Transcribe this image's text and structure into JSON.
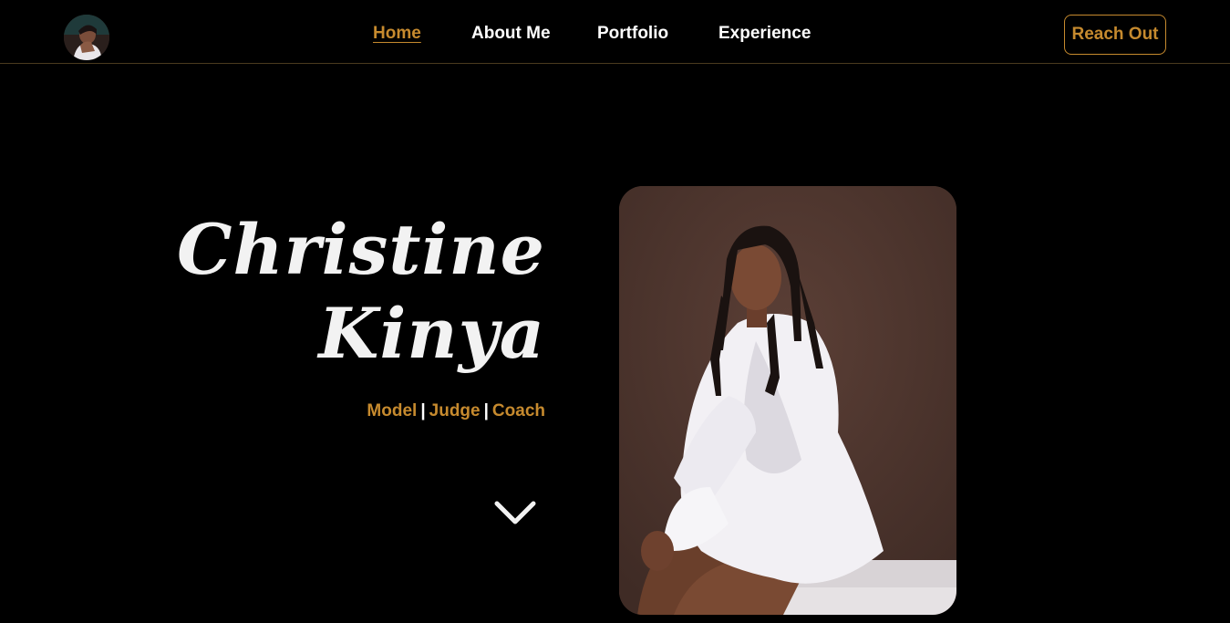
{
  "nav": {
    "logo_alt": "profile-avatar",
    "links": [
      {
        "label": "Home",
        "active": true
      },
      {
        "label": "About Me",
        "active": false
      },
      {
        "label": "Portfolio",
        "active": false
      },
      {
        "label": "Experience",
        "active": false
      }
    ],
    "cta_label": "Reach Out"
  },
  "hero": {
    "first_name": "Christine",
    "last_name": "Kinya",
    "roles": [
      "Model",
      "Judge",
      "Coach"
    ],
    "separator": "|",
    "scroll_icon": "chevron-down-icon",
    "photo": "portrait-photo"
  },
  "colors": {
    "background": "#000000",
    "accent": "#c68a2e",
    "text": "#ffffff",
    "photo_background": "#4f3730"
  }
}
